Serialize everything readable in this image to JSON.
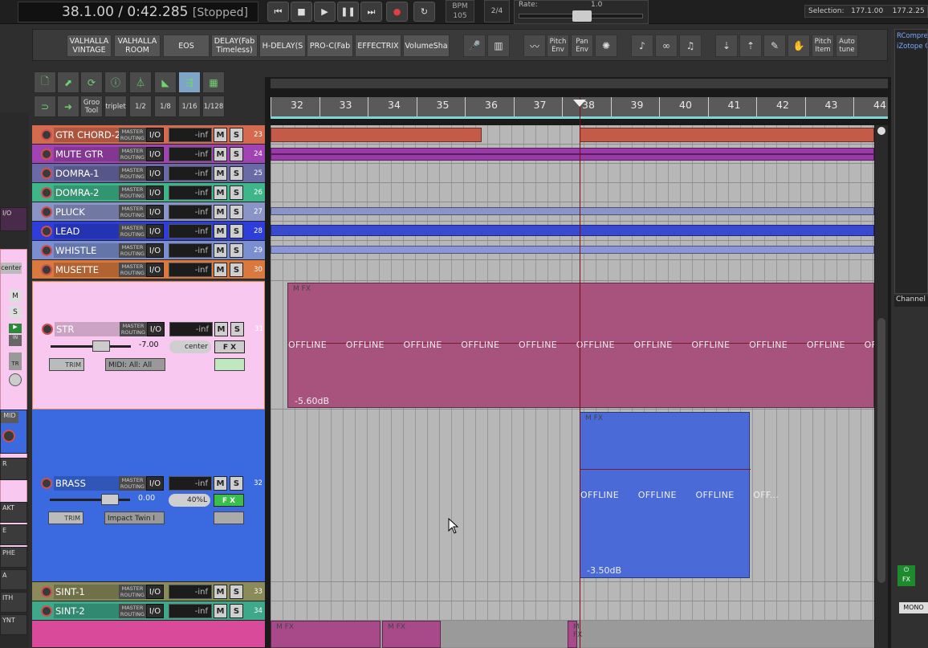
{
  "transport": {
    "position": "38.1.00 / 0:42.285",
    "state": "[Stopped]",
    "bpm_label": "BPM",
    "bpm_value": "105",
    "time_signature": "2/4",
    "rate_label": "Rate:",
    "rate_value": "1.0",
    "selection_label": "Selection:",
    "selection_start": "177.1.00",
    "selection_end": "177.2.25"
  },
  "fx_toolbar": {
    "plugins": [
      "VALHALLA VINTAGE",
      "VALHALLA ROOM",
      "EOS",
      "DELAY(Fab Timeless)",
      "H-DELAY(S",
      "PRO-C(Fab",
      "EFFECTRIX",
      "VolumeSha"
    ],
    "pitch_env": "Pitch Env",
    "pan_env": "Pan Env",
    "pitch_item": "Pitch Item",
    "auto_tune": "Auto tune"
  },
  "tools": {
    "groove_tool": "Groo Tool",
    "triplet": "triplet",
    "grid_half": "1/2",
    "grid_eighth": "1/8",
    "grid_sixteenth": "1/16",
    "grid_128": "1/128"
  },
  "ruler": {
    "bars": [
      "32",
      "33",
      "34",
      "35",
      "36",
      "37",
      "38",
      "39",
      "40",
      "41",
      "42",
      "43",
      "44"
    ]
  },
  "route_text": "MASTER ROUTING",
  "tracks": [
    {
      "name": "GTR CHORD-2",
      "number": "23",
      "io": "I/O",
      "volume": "-inf",
      "mute": "M",
      "solo": "S",
      "color": "#d46a4e"
    },
    {
      "name": "MUTE GTR",
      "number": "24",
      "io": "I/O",
      "volume": "-inf",
      "mute": "M",
      "solo": "S",
      "color": "#a044b4"
    },
    {
      "name": "DOMRA-1",
      "number": "25",
      "io": "I/O",
      "volume": "-inf",
      "mute": "M",
      "solo": "S",
      "color": "#6a6aa6"
    },
    {
      "name": "DOMRA-2",
      "number": "26",
      "io": "I/O",
      "volume": "-inf",
      "mute": "M",
      "solo": "S",
      "color": "#3fb58a"
    },
    {
      "name": "PLUCK",
      "number": "27",
      "io": "I/O",
      "volume": "-inf",
      "mute": "M",
      "solo": "S",
      "color": "#8a94c6"
    },
    {
      "name": "LEAD",
      "number": "28",
      "io": "I/O",
      "volume": "-inf",
      "mute": "M",
      "solo": "S",
      "color": "#2d3fd8"
    },
    {
      "name": "WHISTLE",
      "number": "29",
      "io": "I/O",
      "volume": "-inf",
      "mute": "M",
      "solo": "S",
      "color": "#7b8fd0"
    },
    {
      "name": "MUSETTE",
      "number": "30",
      "io": "I/O",
      "volume": "-inf",
      "mute": "M",
      "solo": "S",
      "color": "#d9793e"
    }
  ],
  "str_track": {
    "name": "STR",
    "number": "31",
    "io": "I/O",
    "volume": "-inf",
    "mute": "M",
    "solo": "S",
    "fader_db": "-7.00",
    "pan": "center",
    "fx": "F X",
    "trim": "TRIM",
    "midi": "MIDI: All: All",
    "item_label": "M FX",
    "item_db": "-5.60dB",
    "offline_text": "OFFLINE",
    "color": "#f8c8f0"
  },
  "brass_track": {
    "name": "BRASS",
    "number": "32",
    "io": "I/O",
    "volume": "-inf",
    "mute": "M",
    "solo": "S",
    "fader_db": "0.00",
    "pan": "40%L",
    "fx": "F X",
    "trim": "TRIM",
    "midi": "Impact Twin I",
    "item_label": "M FX",
    "item_db": "-3.50dB",
    "offline_text": "OFFLINE",
    "offline_last": "OFF...",
    "color": "#3b6ae0"
  },
  "tracks_bottom": [
    {
      "name": "SINT-1",
      "number": "33",
      "io": "I/O",
      "volume": "-inf",
      "mute": "M",
      "solo": "S",
      "color": "#8a8a5a"
    },
    {
      "name": "SINT-2",
      "number": "34",
      "io": "I/O",
      "volume": "-inf",
      "mute": "M",
      "solo": "S",
      "color": "#3ea88a"
    }
  ],
  "bottom_items": {
    "label": "M FX"
  },
  "left_strip": {
    "io": "I/O",
    "pan": "center",
    "mute": "M",
    "solo": "S",
    "in": "IN",
    "tr": "TR",
    "midi": "MID",
    "labels": [
      "R",
      "AKT",
      "E",
      "PHE",
      "A",
      "ITH",
      "YNT"
    ]
  },
  "right_dock": {
    "fx1": "RCompre",
    "fx2": "iZotope O",
    "channel": "Channel T",
    "mono": "MONO",
    "fx_on": "FX"
  }
}
